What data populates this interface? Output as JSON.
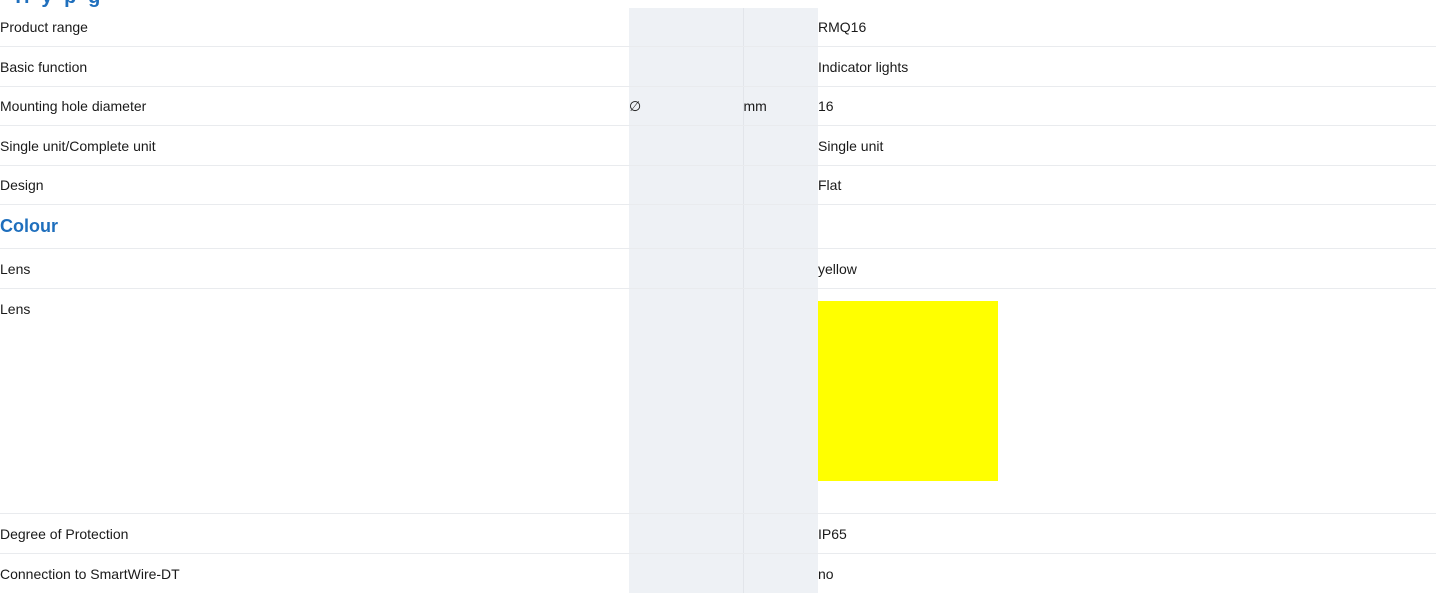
{
  "rows": [
    {
      "label": "Product range",
      "symbol": "",
      "unit": "",
      "value": "RMQ16"
    },
    {
      "label": "Basic function",
      "symbol": "",
      "unit": "",
      "value": "Indicator lights"
    },
    {
      "label": "Mounting hole diameter",
      "symbol": "∅",
      "unit": "mm",
      "value": "16"
    },
    {
      "label": "Single unit/Complete unit",
      "symbol": "",
      "unit": "",
      "value": "Single unit"
    },
    {
      "label": "Design",
      "symbol": "",
      "unit": "",
      "value": "Flat"
    }
  ],
  "colour_section": {
    "heading": "Colour",
    "lens_text_label": "Lens",
    "lens_text_value": "yellow",
    "lens_swatch_label": "Lens",
    "lens_swatch_color": "#ffff00"
  },
  "tail_rows": [
    {
      "label": "Degree of Protection",
      "value": "IP65"
    },
    {
      "label": "Connection to SmartWire-DT",
      "value": "no"
    }
  ],
  "colors": {
    "heading_blue": "#1f6fbd",
    "unit_column_bg": "#eef1f5"
  }
}
